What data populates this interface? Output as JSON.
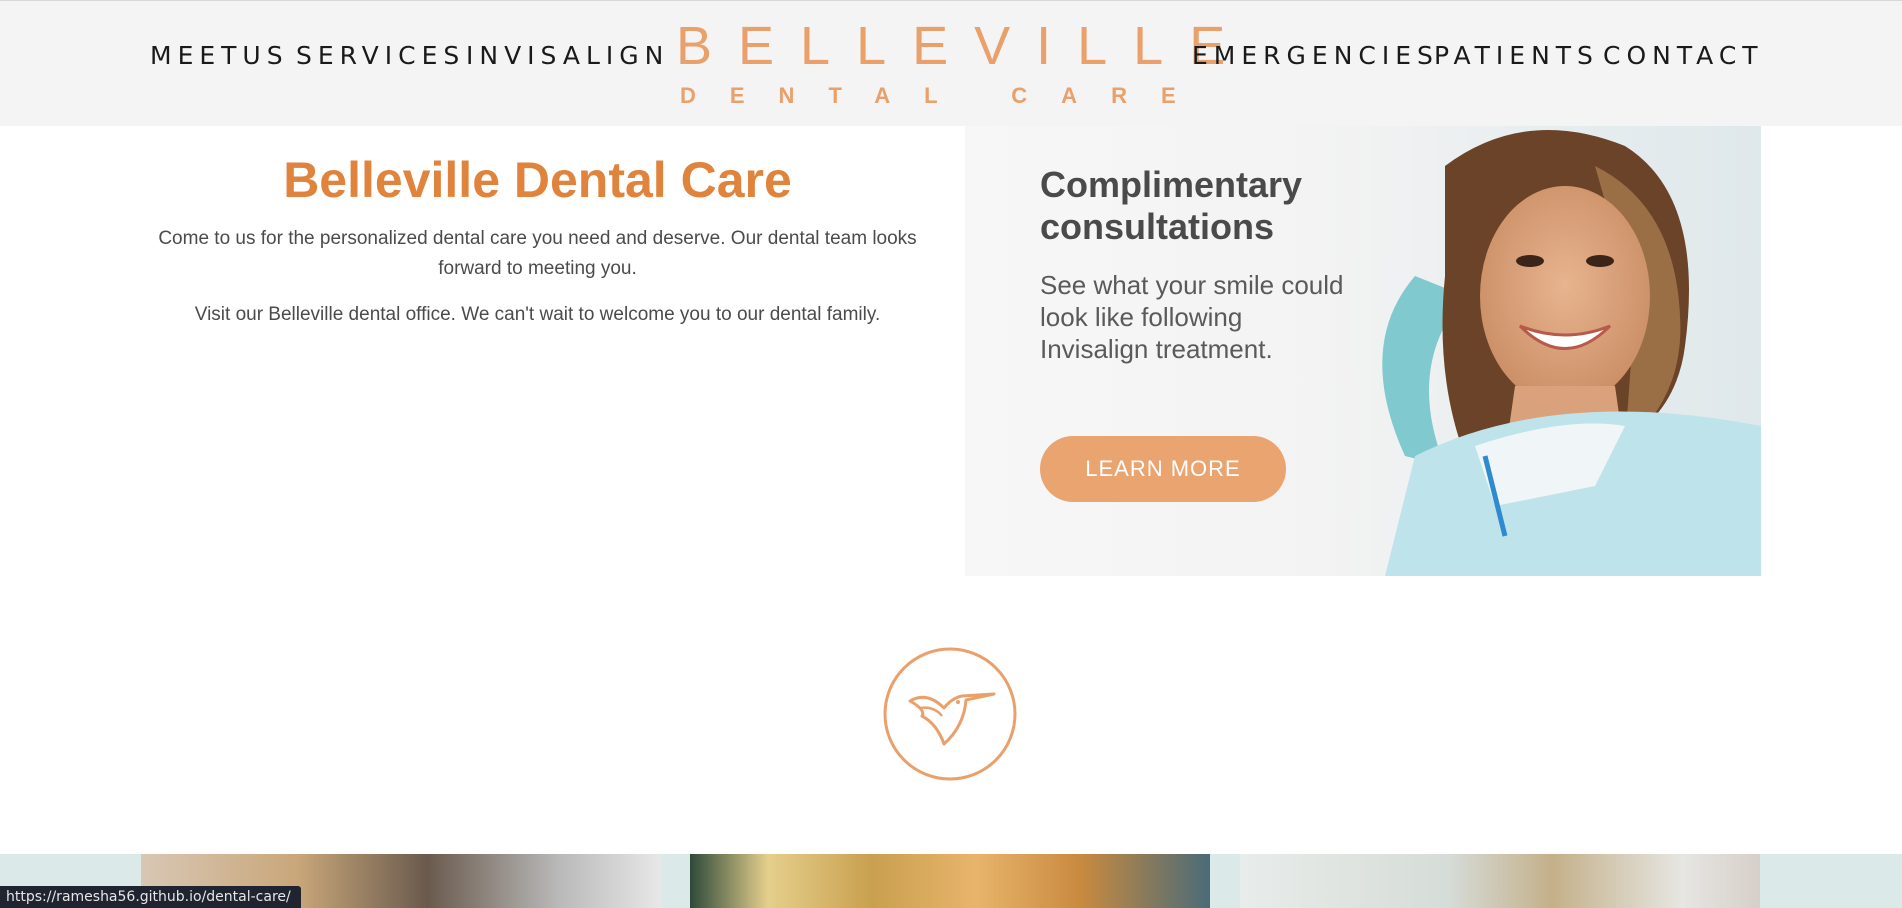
{
  "nav": {
    "left": [
      "MEETUS",
      "SERVICES",
      "INVISALIGN"
    ],
    "right": [
      "EMERGENCIES",
      "PATIENTS",
      "CONTACT"
    ]
  },
  "logo": {
    "main": "BELLEVILLE",
    "sub": "DENTAL CARE",
    "color": "#e9a06a"
  },
  "intro": {
    "title": "Belleville Dental Care",
    "paragraph1": "Come to us for the personalized dental care you need and deserve. Our dental team looks forward to meeting you.",
    "paragraph2": "Visit our Belleville dental office. We can't wait to welcome you to our dental family."
  },
  "promo": {
    "title": "Complimentary consultations",
    "text": "See what your smile could look like following Invisalign treatment.",
    "button": "LEARN MORE",
    "button_color": "#e9a470"
  },
  "icons": {
    "emblem": "hummingbird-icon"
  },
  "status_bar": {
    "url": "https://ramesha56.github.io/dental-care/"
  },
  "colors": {
    "accent": "#e0833c",
    "header_bg": "#f4f4f4"
  }
}
